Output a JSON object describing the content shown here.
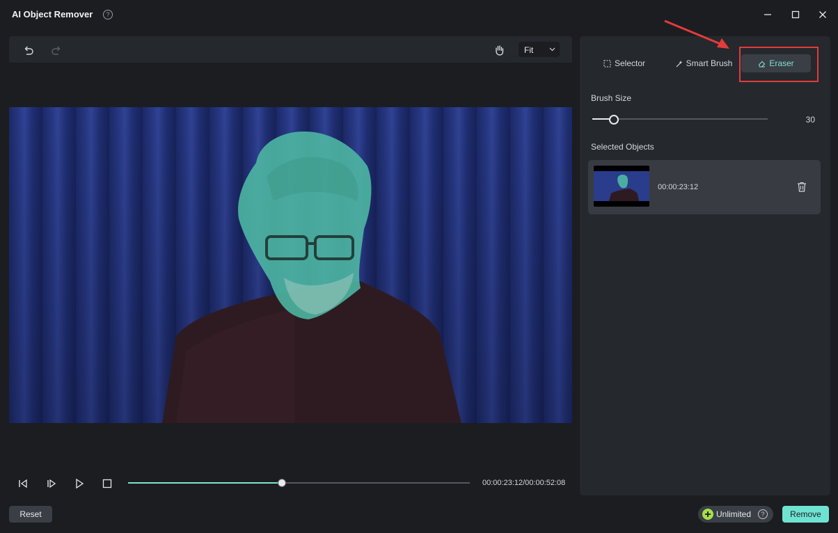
{
  "window": {
    "title": "AI Object Remover",
    "help_glyph": "?"
  },
  "toolbar": {
    "zoom_value": "Fit"
  },
  "playback": {
    "timecode": "00:00:23:12/00:00:52:08",
    "progress_fraction": 0.45
  },
  "tools": {
    "tabs": [
      {
        "label": "Selector",
        "icon": "dashed-square-icon",
        "active": false
      },
      {
        "label": "Smart Brush",
        "icon": "smart-brush-icon",
        "active": false
      },
      {
        "label": "Eraser",
        "icon": "eraser-icon",
        "active": true
      }
    ]
  },
  "brush": {
    "label": "Brush Size",
    "value": "30",
    "slider_fraction": 0.12
  },
  "selected_objects": {
    "label": "Selected Objects",
    "items": [
      {
        "time": "00:00:23:12"
      }
    ]
  },
  "footer": {
    "reset_label": "Reset",
    "unlimited_label": "Unlimited",
    "help_glyph": "?",
    "remove_label": "Remove"
  },
  "colors": {
    "accent": "#6fe3d2",
    "mask": "#4fb9a4",
    "highlight_box": "#e33b3b",
    "background": "#1b1d21",
    "panel": "#25282d"
  }
}
